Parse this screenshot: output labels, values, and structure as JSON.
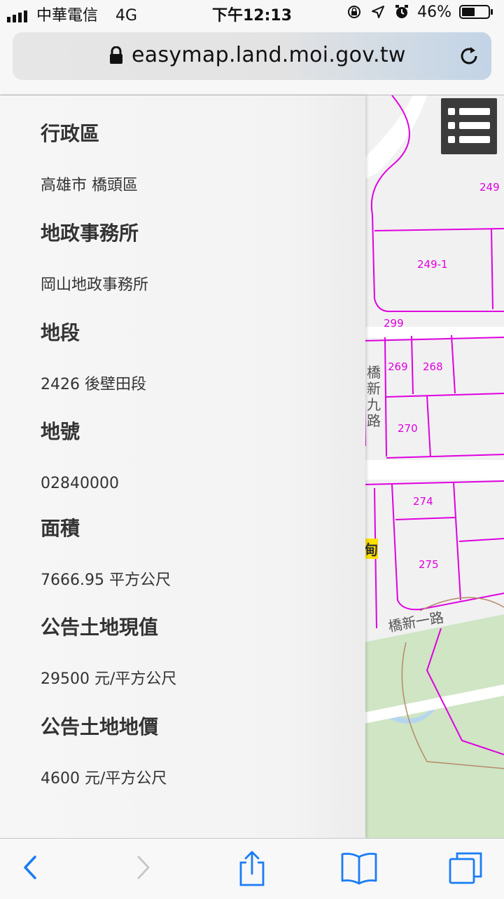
{
  "status_bar": {
    "carrier": "中華電信",
    "network": "4G",
    "time": "下午12:13",
    "battery": "46%",
    "icons": [
      "signal-icon",
      "orientation-lock-icon",
      "location-arrow-icon",
      "alarm-icon",
      "battery-icon"
    ]
  },
  "browser": {
    "url": "easymap.land.moi.gov.tw",
    "icons": [
      "lock-icon",
      "reload-icon"
    ]
  },
  "panel": {
    "sections": [
      {
        "label": "行政區",
        "value": "高雄市 橋頭區"
      },
      {
        "label": "地政事務所",
        "value": "岡山地政事務所"
      },
      {
        "label": "地段",
        "value": "2426 後壁田段"
      },
      {
        "label": "地號",
        "value": "02840000"
      },
      {
        "label": "面積",
        "value": "7666.95 平方公尺"
      },
      {
        "label": "公告土地現值",
        "value": "29500 元/平方公尺"
      },
      {
        "label": "公告土地地價",
        "value": "4600 元/平方公尺"
      }
    ]
  },
  "map": {
    "parcels": [
      "249",
      "249-1",
      "299",
      "269",
      "268",
      "270",
      "274",
      "275"
    ],
    "roads": [
      "橋新九路",
      "橋新一路",
      "甸"
    ],
    "colors": {
      "parcel_line": "#e000e0",
      "green": "#cfe5c4",
      "water": "#b6d6ee",
      "road": "#ffffff"
    }
  },
  "toolbar": {
    "icons": [
      "back-icon",
      "forward-icon",
      "share-icon",
      "bookmarks-icon",
      "tabs-icon"
    ]
  }
}
